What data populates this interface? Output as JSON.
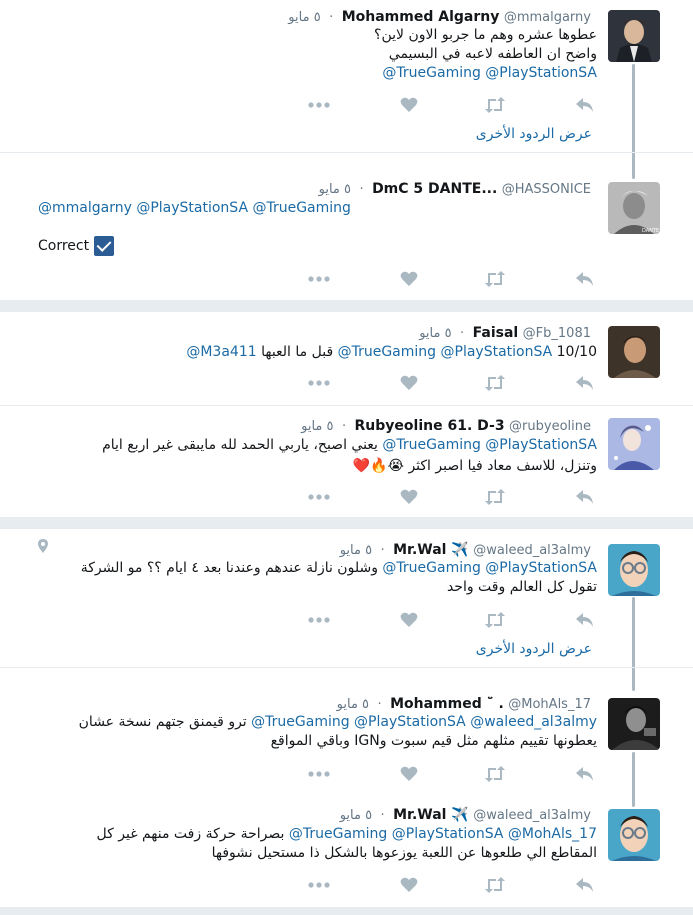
{
  "tweets": [
    {
      "name": "Mohammed Algarny",
      "handle": "@mmalgarny",
      "time": "٥ مايو",
      "line1": "عطوها عشره وهم ما جربو الاون لاين؟",
      "line2": "واضح ان العاطفه لاعبه في البسيمي",
      "mentions": "@TrueGaming @PlayStationSA",
      "more_replies": "عرض الردود الأخرى"
    },
    {
      "name": "DmC 5 DANTE...",
      "handle": "@HASSONICE",
      "time": "٥ مايو",
      "mentions": "@mmalgarny @PlayStationSA @TrueGaming",
      "text": "Correct"
    },
    {
      "name": "Faisal",
      "handle": "@Fb_1081",
      "time": "٥ مايو",
      "mentions": "@TrueGaming @PlayStationSA",
      "text": "10/10 قبل ما العبها",
      "mention_end": "@M3a411"
    },
    {
      "name": "Rubyeoline 61. D-3",
      "handle": "@rubyeoline",
      "time": "٥ مايو",
      "mentions": "@TrueGaming @PlayStationSA",
      "line1": "يعني اصبح، ياربي الحمد لله مايبقى غير اربع ايام",
      "line2": "وتنزل، للاسف معاد فيا اصبر اكثر",
      "emojis": "😭🔥❤️"
    },
    {
      "name": "Mr.Wal",
      "handle": "@waleed_al3almy",
      "time": "٥ مايو",
      "plane": "✈️",
      "mentions": "@TrueGaming @PlayStationSA",
      "line1": "وشلون نازلة عندهم وعندنا بعد ٤ ايام ؟؟ مو الشركة",
      "line2": "تقول كل العالم وقت واحد",
      "more_replies": "عرض الردود الأخرى"
    },
    {
      "name": "Mohammed",
      "name_prefix": "˘̈ .",
      "handle": "@MohAls_17",
      "time": "٥ مايو",
      "mentions": "@TrueGaming @PlayStationSA @waleed_al3almy",
      "line1": "ترو قيمنق جتهم نسخة عشان",
      "line2": "يعطونها تقييم مثلهم مثل قيم سبوت وIGN وباقي المواقع"
    },
    {
      "name": "Mr.Wal",
      "handle": "@waleed_al3almy",
      "time": "٥ مايو",
      "plane": "✈️",
      "mentions": "@TrueGaming @PlayStationSA @MohAls_17",
      "line1": "بصراحة حركة زفت منهم غير كل",
      "line2": "المقاطع الي طلعوها عن اللعبة يوزعوها بالشكل ذا مستحيل نشوفها"
    }
  ],
  "sep": "·",
  "colors": {
    "link": "#1b6aa5",
    "muted": "#657786",
    "icon": "#aab8c2"
  }
}
